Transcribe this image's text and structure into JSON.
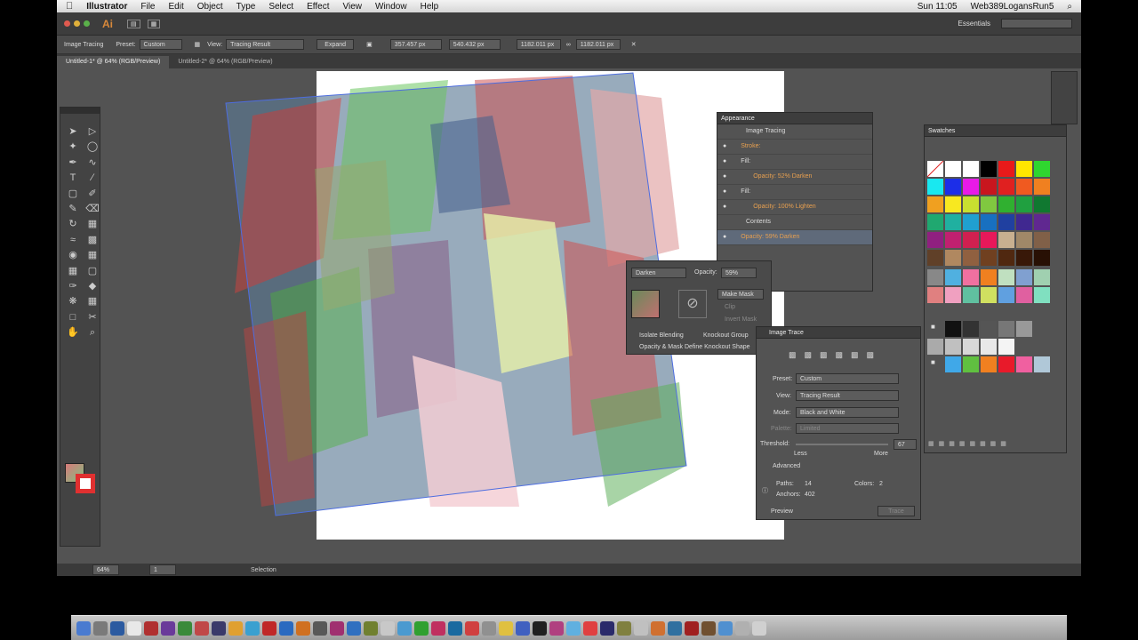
{
  "menubar": {
    "apple": "",
    "app": "Illustrator",
    "items": [
      "File",
      "Edit",
      "Object",
      "Type",
      "Select",
      "Effect",
      "View",
      "Window",
      "Help"
    ],
    "user": "Web389LogansRun5",
    "time": "Sun 11:05"
  },
  "appbar": {
    "logo": "Ai",
    "workspace": "Essentials"
  },
  "control": {
    "image_tracing": "Image Tracing",
    "preset_label": "Preset:",
    "preset_value": "Custom",
    "view_label": "View:",
    "view_value": "Tracing Result",
    "expand": "Expand",
    "x": "357.457 px",
    "y": "540.432 px",
    "w": "1182.011 px",
    "h": "1182.011 px"
  },
  "tabs": [
    "Untitled-1* @ 64% (RGB/Preview)",
    "Untitled-2* @ 64% (RGB/Preview)"
  ],
  "appearance": {
    "title": "Appearance",
    "object": "Image Tracing",
    "stroke": "Stroke:",
    "fill": "Fill:",
    "opacity1": "Opacity: 52% Darken",
    "opacity2": "Opacity: 100% Lighten",
    "contents": "Contents",
    "opacity3": "Opacity: 59% Darken"
  },
  "transparency": {
    "mode": "Darken",
    "opacity_label": "Opacity:",
    "opacity_value": "59%",
    "make_mask": "Make Mask",
    "clip": "Clip",
    "invert": "Invert Mask",
    "isolate": "Isolate Blending",
    "knockout": "Knockout Group",
    "define": "Opacity & Mask Define Knockout Shape"
  },
  "trace": {
    "title": "Image Trace",
    "preset_label": "Preset:",
    "preset": "Custom",
    "view_label": "View:",
    "view": "Tracing Result",
    "mode_label": "Mode:",
    "mode": "Black and White",
    "palette_label": "Palette:",
    "palette": "Limited",
    "threshold_label": "Threshold:",
    "threshold": "67",
    "less": "Less",
    "more": "More",
    "advanced": "Advanced",
    "paths_label": "Paths:",
    "paths": "14",
    "colors_label": "Colors:",
    "colors": "2",
    "anchors_label": "Anchors:",
    "anchors": "402",
    "preview": "Preview",
    "trace": "Trace"
  },
  "swatches": {
    "title": "Swatches"
  },
  "status": {
    "zoom": "64%",
    "page": "1",
    "tool": "Selection"
  },
  "colors": {
    "accent": "#e8a050",
    "dock": [
      "#4a7bd0",
      "#7a7a7a",
      "#2b5aa0",
      "#e8e8e8",
      "#b03030",
      "#6a3a9a",
      "#3a8a3a",
      "#c04848",
      "#3a3a6a",
      "#e0a030",
      "#3aa0d0",
      "#c02828",
      "#2a6ac0",
      "#d07020",
      "#585858",
      "#a03070",
      "#3070c0",
      "#708030",
      "#c8c8c8",
      "#4a9ad0",
      "#30a030",
      "#c03060",
      "#1a6aa0",
      "#d04040",
      "#909090",
      "#e0c040",
      "#4060c0",
      "#202020",
      "#b04080",
      "#60b0e0",
      "#e04040",
      "#2a2a6a",
      "#808040",
      "#c0c0c0",
      "#d07030",
      "#3070a0",
      "#a02020",
      "#705030",
      "#5090d0",
      "#b0b0b0",
      "#d0d0d0"
    ]
  }
}
